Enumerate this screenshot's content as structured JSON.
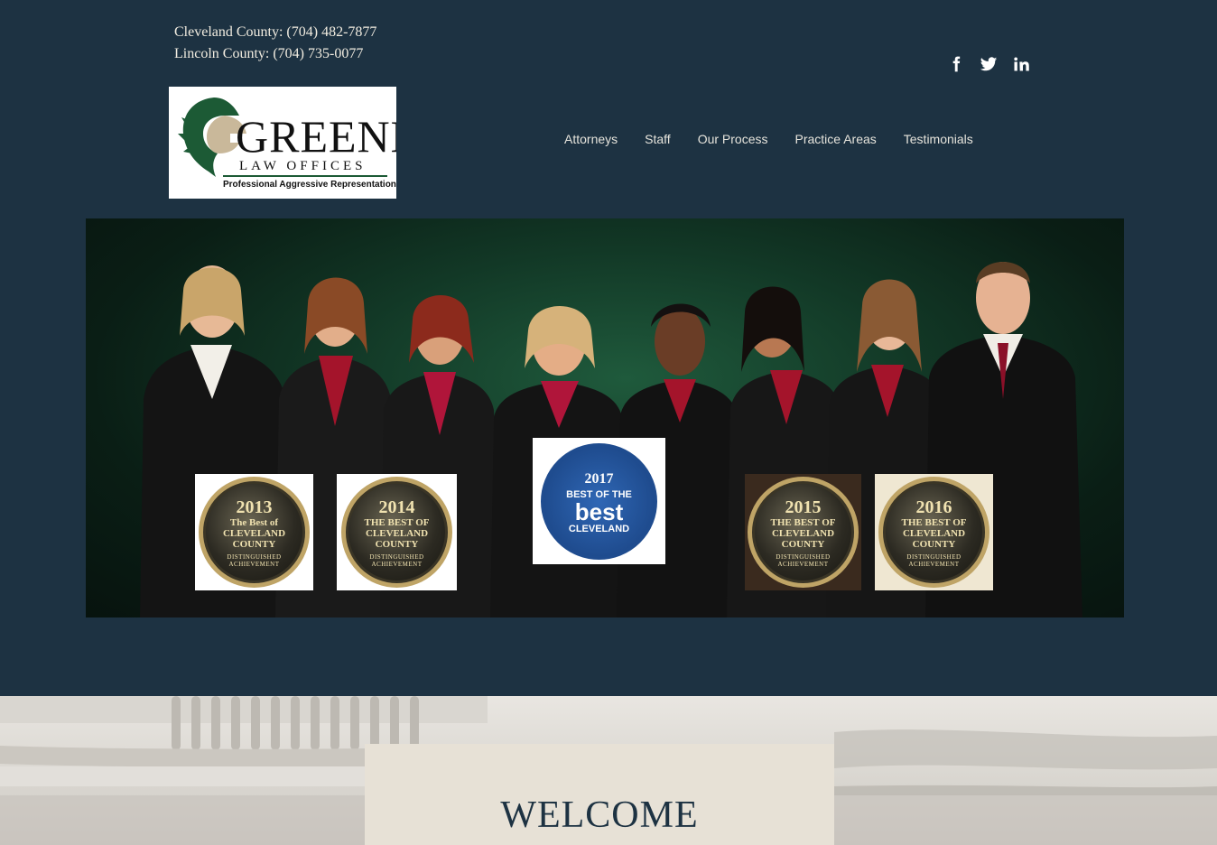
{
  "header": {
    "phones": [
      "Cleveland County: (704) 482-7877",
      "Lincoln County: (704) 735-0077"
    ],
    "social": [
      {
        "icon": "facebook-icon"
      },
      {
        "icon": "twitter-icon"
      },
      {
        "icon": "linkedin-icon"
      }
    ]
  },
  "logo": {
    "wordmark": "GREENE",
    "subtitle": "LAW OFFICES",
    "tagline": "Professional Aggressive Representation"
  },
  "nav": [
    "Attorneys",
    "Staff",
    "Our Process",
    "Practice Areas",
    "Testimonials"
  ],
  "badges": [
    {
      "year": "2013",
      "title": "The Best of CLEVELAND COUNTY",
      "note": "DISTINGUISHED ACHIEVEMENT"
    },
    {
      "year": "2014",
      "title": "THE BEST OF CLEVELAND COUNTY",
      "note": "DISTINGUISHED ACHIEVEMENT"
    },
    {
      "year": "2017",
      "title": "BEST OF THE",
      "big": "best",
      "sub": "CLEVELAND"
    },
    {
      "year": "2015",
      "title": "THE BEST OF CLEVELAND COUNTY",
      "note": "DISTINGUISHED ACHIEVEMENT"
    },
    {
      "year": "2016",
      "title": "THE BEST OF CLEVELAND COUNTY",
      "note": "DISTINGUISHED ACHIEVEMENT"
    }
  ],
  "welcome": {
    "heading": "WELCOME"
  },
  "colors": {
    "page_bg": "#1d3242",
    "brand_green": "#1c5a35",
    "welcome_bg": "#e7e1d6"
  }
}
